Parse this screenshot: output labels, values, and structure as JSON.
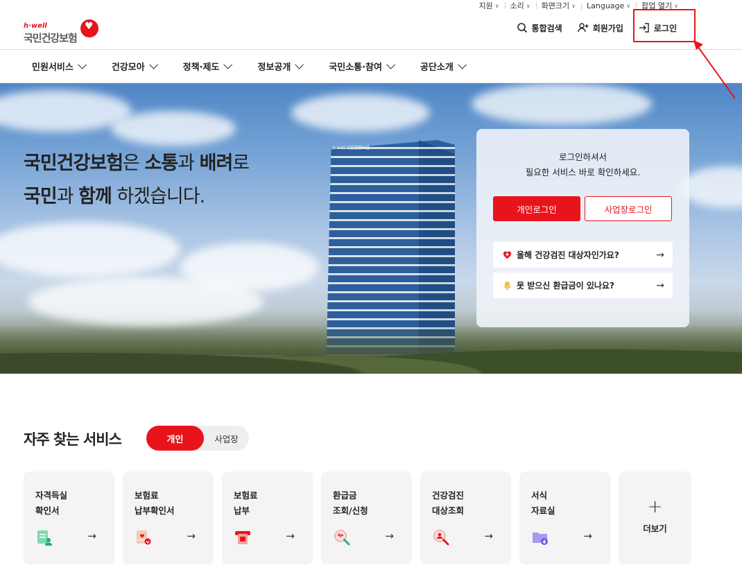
{
  "utility": {
    "items": [
      {
        "label": "지원"
      },
      {
        "label": "소리"
      },
      {
        "label": "화면크기"
      },
      {
        "label": "Language"
      },
      {
        "label": "팝업 열기"
      }
    ]
  },
  "header": {
    "logo_small": "h·well",
    "logo_main": "국민건강보험",
    "search_label": "통합검색",
    "join_label": "회원가입",
    "login_label": "로그인"
  },
  "gnb": {
    "items": [
      {
        "label": "민원서비스"
      },
      {
        "label": "건강모아"
      },
      {
        "label": "정책·제도"
      },
      {
        "label": "정보공개"
      },
      {
        "label": "국민소통·참여"
      },
      {
        "label": "공단소개"
      }
    ]
  },
  "hero": {
    "line1": {
      "a": "국민건강보험",
      "b": "은 ",
      "c": "소통",
      "d": "과 ",
      "e": "배려",
      "f": "로"
    },
    "line2": {
      "a": "국민",
      "b": "과 ",
      "c": "함께",
      "d": " 하겠습니다."
    },
    "building_sign": "h·well 국민건강보험"
  },
  "login_card": {
    "msg_line1": "로그인하셔서",
    "msg_line2": "필요한 서비스 바로 확인하세요.",
    "personal_login": "개인로그인",
    "business_login": "사업장로그인",
    "link1": "올해 건강검진 대상자인가요?",
    "link2": "못 받으신 환급금이 있나요?"
  },
  "services": {
    "title": "자주 찾는 서비스",
    "toggle_on": "개인",
    "toggle_off": "사업장",
    "cards": [
      {
        "label": "자격득실\n확인서",
        "icon": "certificate-icon"
      },
      {
        "label": "보험료\n납부확인서",
        "icon": "receipt-icon"
      },
      {
        "label": "보험료\n납부",
        "icon": "payment-icon"
      },
      {
        "label": "환급금\n조회/신청",
        "icon": "refund-search-icon"
      },
      {
        "label": "건강검진\n대상조회",
        "icon": "person-search-icon"
      },
      {
        "label": "서식\n자료실",
        "icon": "folder-download-icon"
      }
    ],
    "more_label": "더보기"
  },
  "colors": {
    "brand_red": "#e8141c"
  }
}
